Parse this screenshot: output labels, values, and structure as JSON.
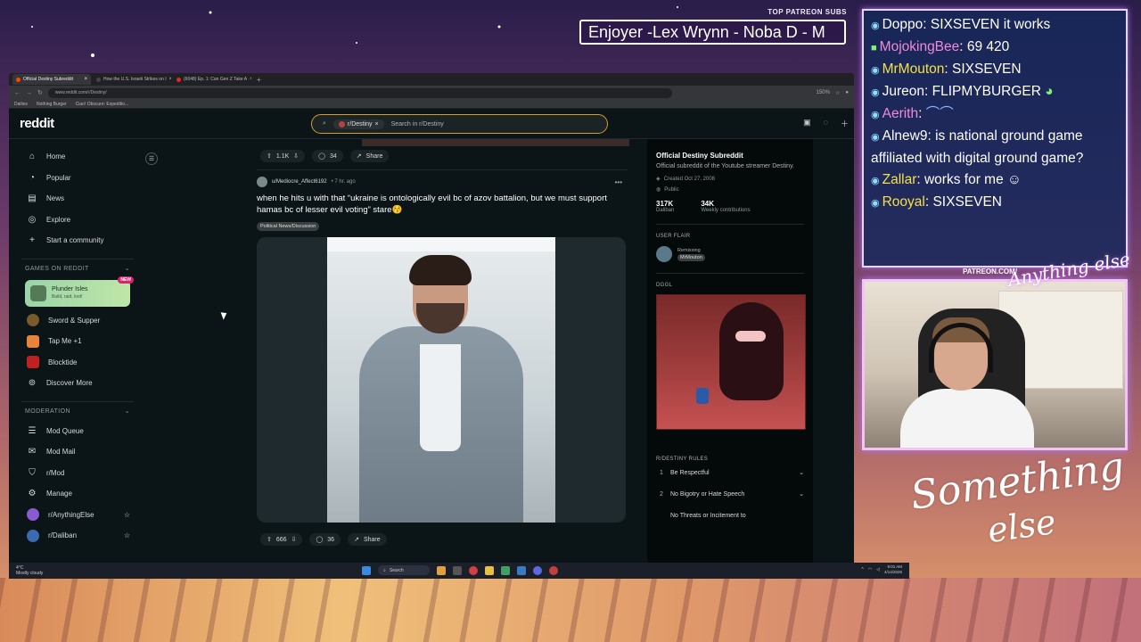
{
  "overlay": {
    "top_label": "TOP PATREON SUBS",
    "ticker_text": "Enjoyer -Lex Wrynn -  Noba D - M",
    "patreon_url": "PATREON.COM/",
    "cam_logo": "Anything else",
    "brand_line1": "Something",
    "brand_line2": "else"
  },
  "chat": {
    "messages": [
      {
        "user": "Doppo",
        "text": ": SIXSEVEN it works",
        "user_color": "#ffffff"
      },
      {
        "user": "MojokingBee",
        "text": ": 69 420",
        "user_color": "#f08ad8"
      },
      {
        "user": "MrMouton",
        "text": ": SIXSEVEN",
        "user_color": "#f4e04a"
      },
      {
        "user": "Jureon",
        "text": ": FLIPMYBURGER",
        "user_color": "#ffffff"
      },
      {
        "user": "Aerith",
        "text": ":",
        "user_color": "#f08ad8"
      },
      {
        "user": "Alnew9",
        "text": ": is national ground game affiliated with digital ground game?",
        "user_color": "#ffffff"
      },
      {
        "user": "Zallar",
        "text": ": works for me",
        "user_color": "#f4e04a"
      },
      {
        "user": "Rooyal",
        "text": ": SIXSEVEN",
        "user_color": "#f4e04a"
      }
    ]
  },
  "browser": {
    "tabs": [
      {
        "label": "Official Destiny Subreddit",
        "active": true
      },
      {
        "label": "How the U.S. Israeli Strikes on I",
        "active": false
      },
      {
        "label": "(6048) Ep. 1: Can Gen Z Take A",
        "active": false
      }
    ],
    "url": "www.reddit.com/r/Destiny/",
    "zoom": "150%",
    "bookmarks": [
      "Dailies",
      "Nothing Burger",
      "Ciao! Obscure: Expeditio..."
    ]
  },
  "reddit": {
    "logo": "reddit",
    "search": {
      "chip": "r/Destiny",
      "placeholder": "Search in r/Destiny"
    },
    "left_nav": {
      "main": [
        "Home",
        "Popular",
        "News",
        "Explore",
        "Start a community"
      ],
      "games_header": "GAMES ON REDDIT",
      "featured_game": {
        "title": "Plunder Isles",
        "subtitle": "Build, raid, loot!",
        "badge": "NEW"
      },
      "games": [
        "Sword & Supper",
        "Tap Me +1",
        "Blocktide",
        "Discover More"
      ],
      "moderation_header": "MODERATION",
      "moderation": [
        "Mod Queue",
        "Mod Mail",
        "r/Mod",
        "Manage",
        "r/AnythingElse",
        "r/Daliban"
      ]
    },
    "prev_post": {
      "votes": "1.1K",
      "comments": "34",
      "share": "Share"
    },
    "post": {
      "author": "u/Mediocre_Affect6192",
      "time": "• 7 hr. ago",
      "title": "when he hits u with that “ukraine is ontologically evil bc of azov battalion, but we must support hamas bc of lesser evil voting” stare😚",
      "flair": "Political News/Discussion",
      "votes": "666",
      "comments": "36",
      "share": "Share"
    },
    "right_sidebar": {
      "title": "Official Destiny Subreddit",
      "description": "Official subreddit of the Youtube streamer Destiny.",
      "created": "Created Oct 27, 2008",
      "visibility": "Public",
      "stats": [
        {
          "value": "317K",
          "label": "Daliban"
        },
        {
          "value": "34K",
          "label": "Weekly contributions"
        }
      ],
      "user_flair_header": "USER FLAIR",
      "user_flair_line1": "Remixxing",
      "user_flair_badge": "MrMouton",
      "dggl_header": "DGGL",
      "rules_header": "R/DESTINY RULES",
      "rules": [
        {
          "n": "1",
          "text": "Be Respectful"
        },
        {
          "n": "2",
          "text": "No Bigotry or Hate Speech"
        },
        {
          "n": "",
          "text": "No Threats or Incitement to"
        }
      ]
    }
  },
  "taskbar": {
    "weather_line1": "4°C",
    "weather_line2": "Mostly cloudy",
    "search": "Search",
    "time": "9:01 AM",
    "date": "4/14/2026"
  }
}
